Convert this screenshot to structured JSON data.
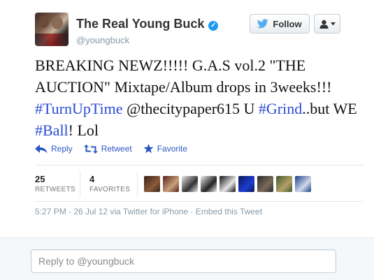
{
  "colors": {
    "link": "#2b4bd6",
    "action": "#2a57c2",
    "twitter_blue": "#55acee",
    "verified": "#1d9bf0",
    "muted": "#8899a6"
  },
  "author": {
    "name": "The Real Young Buck",
    "handle": "@youngbuck",
    "verified": true
  },
  "header": {
    "follow_label": "Follow",
    "follow_icon": "twitter-bird-icon",
    "user_menu_icon": "user-dropdown-icon"
  },
  "tweet": {
    "segments": [
      {
        "text": "BREAKING NEWZ!!!!! G.A.S vol.2 \"THE AUCTION\" Mixtape/Album drops in 3weeks!!! ",
        "type": "text"
      },
      {
        "text": "#TurnUpTime",
        "type": "hashtag"
      },
      {
        "text": " @thecitypaper615 U ",
        "type": "text"
      },
      {
        "text": "#Grind",
        "type": "hashtag"
      },
      {
        "text": "..but WE ",
        "type": "text"
      },
      {
        "text": "#Ball",
        "type": "hashtag"
      },
      {
        "text": "! Lol",
        "type": "text"
      }
    ]
  },
  "actions": {
    "reply_label": "Reply",
    "retweet_label": "Retweet",
    "favorite_label": "Favorite"
  },
  "stats": {
    "retweets_count": "25",
    "retweets_label": "RETWEETS",
    "favorites_count": "4",
    "favorites_label": "FAVORITES"
  },
  "retweeter_avatars": [
    {
      "colors": [
        "#3a2418",
        "#8a5a3a"
      ]
    },
    {
      "colors": [
        "#5a1f1f",
        "#c9a17a"
      ]
    },
    {
      "colors": [
        "#e8e8e8",
        "#333333"
      ]
    },
    {
      "colors": [
        "#f0f0f0",
        "#222222"
      ]
    },
    {
      "colors": [
        "#111111",
        "#e5e5e5"
      ]
    },
    {
      "colors": [
        "#0a1a55",
        "#1d3bd0"
      ]
    },
    {
      "colors": [
        "#2a2a2a",
        "#7a6a5a"
      ]
    },
    {
      "colors": [
        "#3d5a2a",
        "#b5a06a"
      ]
    },
    {
      "colors": [
        "#1a3e8a",
        "#d0d8e8"
      ]
    }
  ],
  "meta": {
    "text": "5:27 PM - 26 Jul 12 via Twitter for iPhone · Embed this Tweet"
  },
  "reply": {
    "placeholder": "Reply to @youngbuck"
  }
}
